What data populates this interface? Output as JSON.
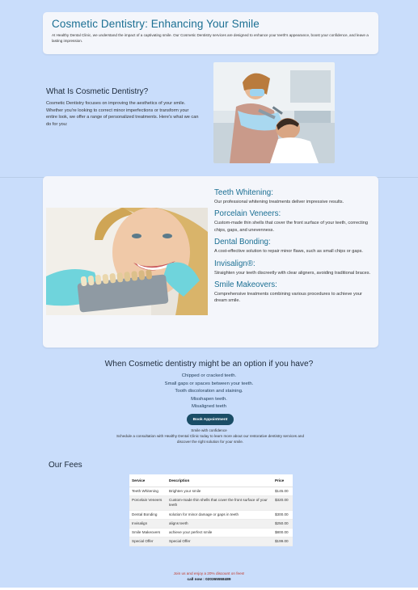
{
  "hero": {
    "title": "Cosmetic Dentistry: Enhancing Your Smile",
    "text": "At Healthy Dental Clinic, we understand the impact of a captivating smile. Our Cosmetic Dentistry services are designed to enhance your teeth's appearance, boost your confidence, and leave a lasting impression."
  },
  "what": {
    "title": "What Is Cosmetic Dentistry?",
    "text": "Cosmetic Dentistry focuses on improving the aesthetics of your smile. Whether you're looking to correct minor imperfections or transform your entire look, we offer a range of personalized treatments. Here's what we can do for you:"
  },
  "services": [
    {
      "title": "Teeth Whitening:",
      "text": "Our professional whitening treatments deliver impressive results."
    },
    {
      "title": "Porcelain Veneers:",
      "text": "Custom-made thin shells that cover the front surface of your teeth, correcting chips, gaps, and unevenness."
    },
    {
      "title": "Dental Bonding:",
      "text": "A cost-effective solution to repair minor flaws, such as small chips or gaps."
    },
    {
      "title": "Invisalign®:",
      "text": "Straighten your teeth discreetly with clear aligners, avoiding traditional braces."
    },
    {
      "title": "Smile Makeovers:",
      "text": "Comprehensive treatments combining various procedures to achieve your dream smile."
    }
  ],
  "when": {
    "title": "When Cosmetic dentistry might be an option if you have?",
    "items": [
      "Chipped or cracked teeth.",
      "Small gaps or spaces between your teeth.",
      "Tooth discoloration and staining.",
      "Misshapen teeth.",
      "Misaligned teeth"
    ],
    "button": "Book Appointment",
    "smile": "Smile with confidence",
    "schedule": "Schedule a consultation with Healthy Dental Clinic today to learn more about our restorative dentistry services and discover the right solution for your smile."
  },
  "fees": {
    "title": "Our Fees",
    "headers": [
      "Service",
      "Description",
      "Price"
    ],
    "rows": [
      [
        "Teeth Whitening",
        "Brighten your smile",
        "$145.00"
      ],
      [
        "Porcelain Veneers",
        "Custom-made thin shells that cover the front surface of your teeth",
        "$320.00"
      ],
      [
        "Dental Bonding",
        "solution for minor damage or gaps in teeth",
        "$300.00"
      ],
      [
        "Invisalign",
        "aligns teeth",
        "$250.00"
      ],
      [
        "Smile Makeovers",
        "achieve your perfect smile",
        "$800.00"
      ],
      [
        "Special Offer",
        "Special Offer",
        "$199.00"
      ]
    ],
    "discount": "Join us and enjoy a 20% discount on fees!",
    "call": "call now : 020365558489"
  },
  "colors": {
    "accent": "#1b6f93",
    "background": "#c9ddfb",
    "button": "#1a4d66"
  }
}
